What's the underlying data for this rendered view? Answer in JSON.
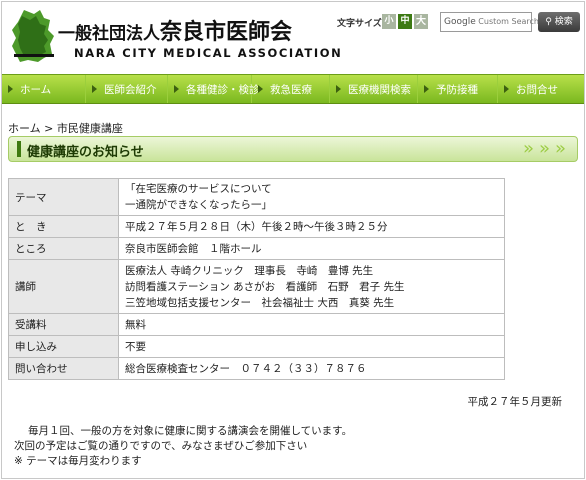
{
  "header": {
    "org_prefix": "一般社団法人",
    "org_name": "奈良市医師会",
    "org_name_en": "NARA CITY MEDICAL ASSOCIATION",
    "font_size_label": "文字サイズ",
    "font_sizes": [
      "小",
      "中",
      "大"
    ],
    "search_brand": "Google",
    "search_placeholder": "Custom Search",
    "search_button": "検索"
  },
  "nav": {
    "items": [
      {
        "label": "ホーム"
      },
      {
        "label": "医師会紹介"
      },
      {
        "label": "各種健診・検診"
      },
      {
        "label": "救急医療"
      },
      {
        "label": "医療機関検索"
      },
      {
        "label": "予防接種"
      },
      {
        "label": "お問合せ"
      }
    ]
  },
  "breadcrumb": {
    "home": "ホーム",
    "separator": ">",
    "current": "市民健康講座"
  },
  "page_heading": "健康講座のお知らせ",
  "info": {
    "rows": [
      {
        "label": "テーマ",
        "lines": [
          "「在宅医療のサービスについて",
          "一通院ができなくなったら一」"
        ]
      },
      {
        "label": "と　き",
        "lines": [
          "平成２７年５月２８日（木）午後２時～午後３時２５分"
        ]
      },
      {
        "label": "ところ",
        "lines": [
          "奈良市医師会館　１階ホール"
        ]
      },
      {
        "label": "講師",
        "lines": [
          "医療法人 寺崎クリニック　理事長　寺崎　豊博 先生",
          "訪問看護ステーション あさがお　看護師　石野　君子 先生",
          "三笠地域包括支援センター　社会福祉士 大西　真葵 先生"
        ]
      },
      {
        "label": "受講料",
        "lines": [
          "無料"
        ]
      },
      {
        "label": "申し込み",
        "lines": [
          "不要"
        ]
      },
      {
        "label": "問い合わせ",
        "lines": [
          "総合医療検査センター　０７４２（３３）７８７６"
        ]
      }
    ]
  },
  "updated": "平成２７年５月更新",
  "notes": [
    "毎月１回、一般の方を対象に健康に関する講演会を開催しています。",
    "次回の予定はご覧の通りですので、みなさまぜひご参加下さい",
    "※ テーマは毎月変わります"
  ]
}
